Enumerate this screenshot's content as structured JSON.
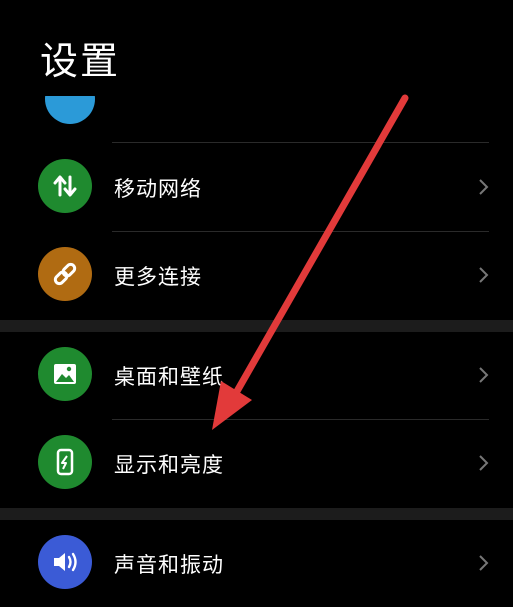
{
  "header": {
    "title": "设置"
  },
  "colors": {
    "background": "#000000",
    "mobile_network_icon": "#1f8a2f",
    "more_connections_icon": "#b06b12",
    "wallpaper_icon": "#1f8a2f",
    "display_icon": "#1f8a2f",
    "sound_icon": "#3b5bd6",
    "partial_icon": "#2b9ad8",
    "annotation_arrow": "#e23a3a"
  },
  "settings": {
    "items": [
      {
        "label": "移动网络",
        "icon": "up-down-arrows-icon"
      },
      {
        "label": "更多连接",
        "icon": "link-icon"
      },
      {
        "label": "桌面和壁纸",
        "icon": "image-icon"
      },
      {
        "label": "显示和亮度",
        "icon": "phone-brightness-icon"
      },
      {
        "label": "声音和振动",
        "icon": "speaker-icon"
      }
    ]
  }
}
